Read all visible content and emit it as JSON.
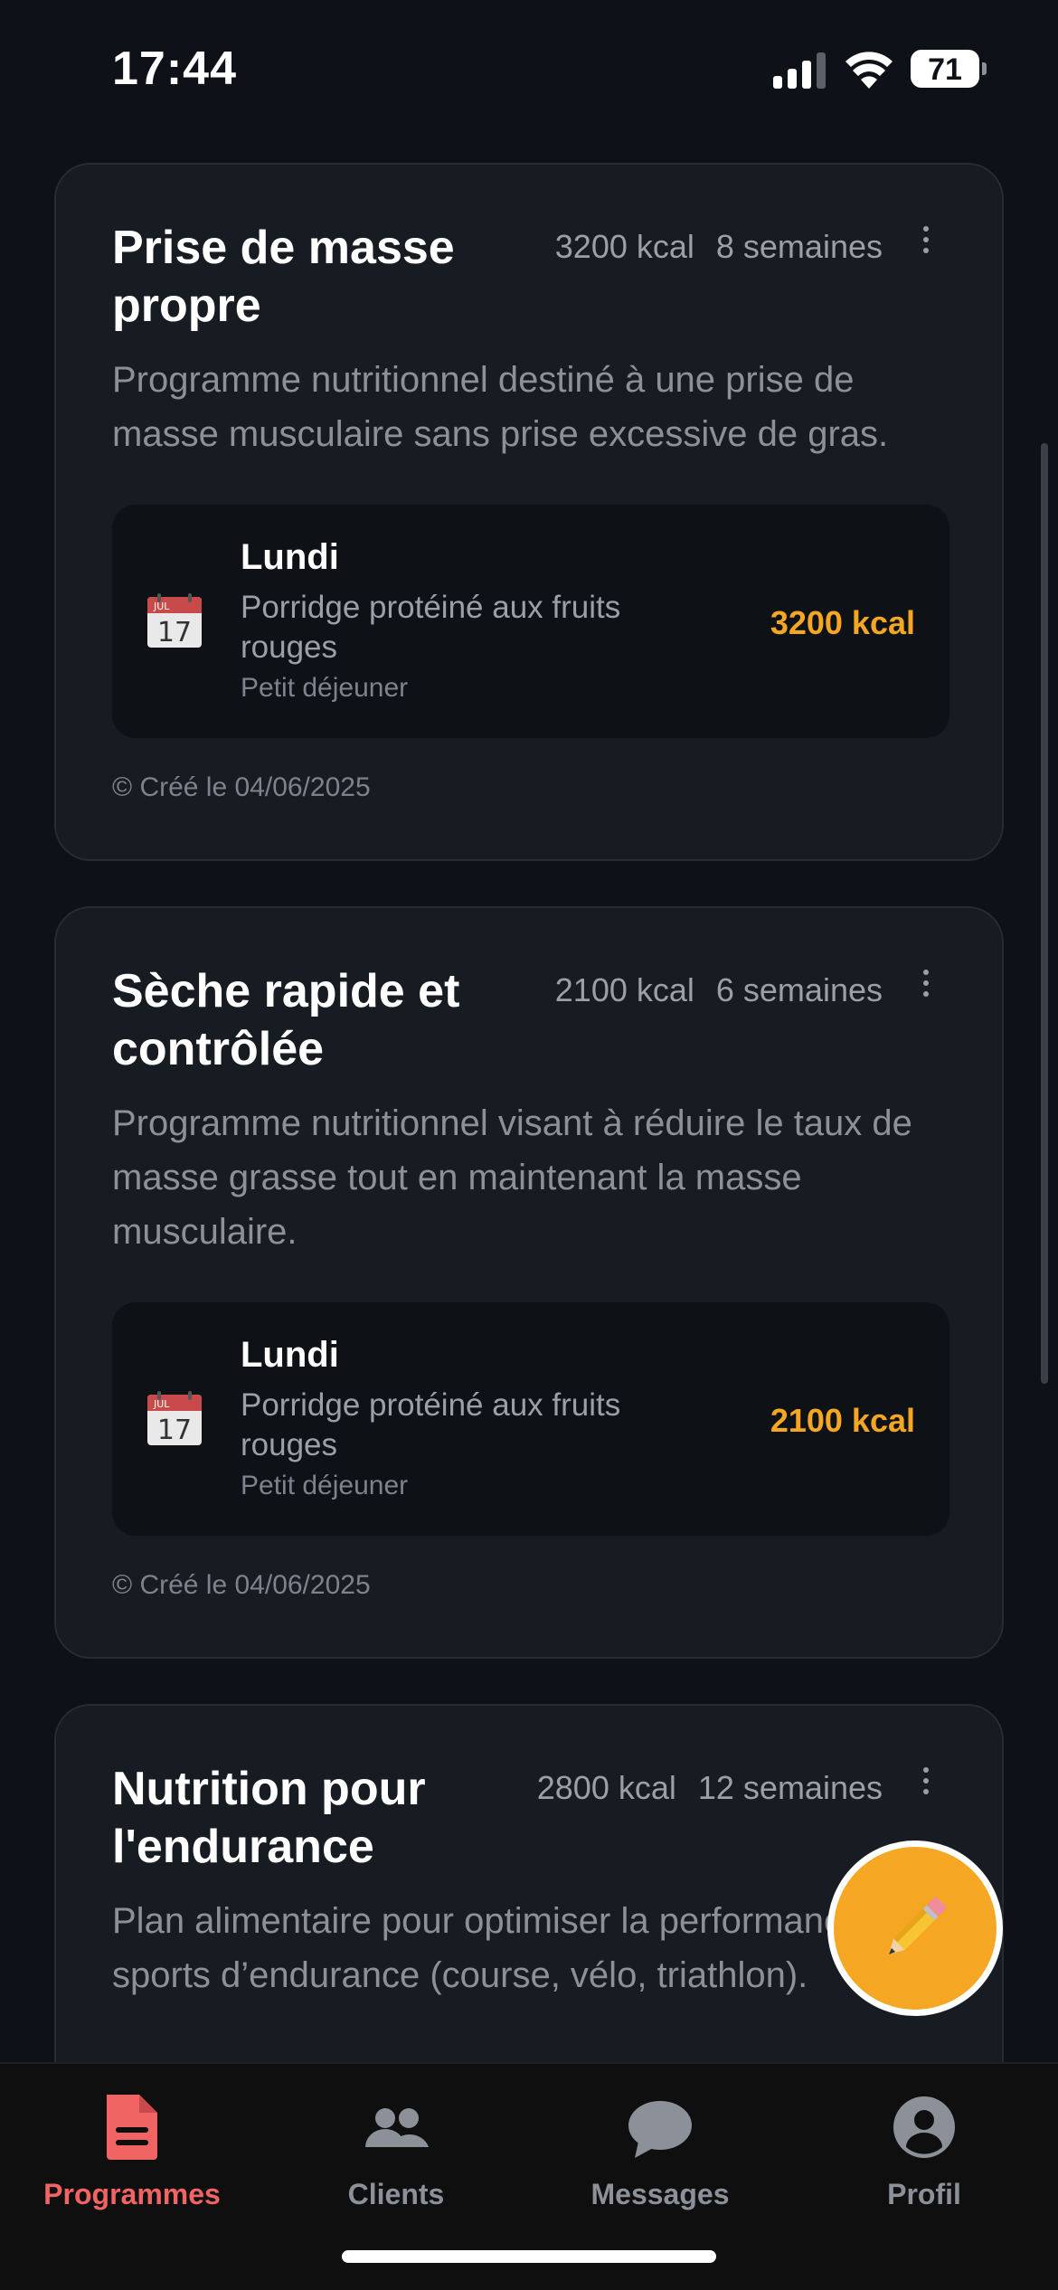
{
  "status_bar": {
    "time": "17:44",
    "battery": "71"
  },
  "programs": [
    {
      "title": "Prise de masse propre",
      "kcal": "3200 kcal",
      "duration": "8 semaines",
      "description": "Programme nutritionnel destiné à une prise de masse musculaire sans prise excessive de gras.",
      "meal": {
        "day": "Lundi",
        "name": "Porridge protéiné aux fruits rouges",
        "type": "Petit déjeuner",
        "kcal": "3200 kcal"
      },
      "created": "© Créé le 04/06/2025"
    },
    {
      "title": "Sèche rapide et contrôlée",
      "kcal": "2100 kcal",
      "duration": "6 semaines",
      "description": "Programme nutritionnel visant à réduire le taux de masse grasse tout en maintenant la masse musculaire.",
      "meal": {
        "day": "Lundi",
        "name": "Porridge protéiné aux fruits rouges",
        "type": "Petit déjeuner",
        "kcal": "2100 kcal"
      },
      "created": "© Créé le 04/06/2025"
    },
    {
      "title": "Nutrition pour l'endurance",
      "kcal": "2800 kcal",
      "duration": "12 semaines",
      "description": "Plan alimentaire pour optimiser la performance sur sports d’endurance (course, vélo, triathlon)."
    }
  ],
  "calendar_icon": {
    "month": "JUL",
    "day": "17"
  },
  "tabs": [
    {
      "label": "Programmes",
      "icon": "document-icon",
      "active": true
    },
    {
      "label": "Clients",
      "icon": "people-icon",
      "active": false
    },
    {
      "label": "Messages",
      "icon": "chat-bubble-icon",
      "active": false
    },
    {
      "label": "Profil",
      "icon": "user-circle-icon",
      "active": false
    }
  ],
  "colors": {
    "accent": "#f5a623",
    "active_tab": "#f06464",
    "card_bg": "#171b22",
    "bg": "#0e1117"
  },
  "fab_icon": "pencil-icon"
}
